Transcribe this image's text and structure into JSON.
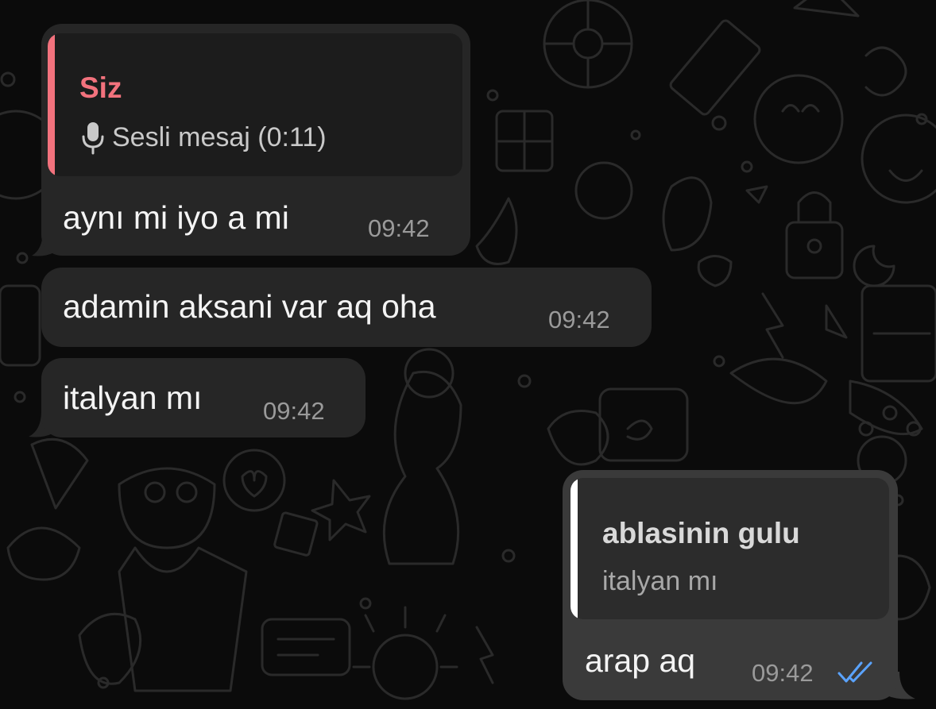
{
  "colors": {
    "incoming_bubble": "#262626",
    "outgoing_bubble": "#3a3a3a",
    "reply_accent_you": "#f2727d",
    "reply_accent_other": "#ffffff",
    "read_ticks": "#5aa3ff",
    "timestamp": "#9a9a9a"
  },
  "messages": [
    {
      "direction": "incoming",
      "reply": {
        "name": "Siz",
        "icon": "microphone-icon",
        "body": "Sesli mesaj (0:11)"
      },
      "text": "aynı mi iyo a mi",
      "time": "09:42"
    },
    {
      "direction": "incoming",
      "text": "adamin aksani var aq oha",
      "time": "09:42"
    },
    {
      "direction": "incoming",
      "text": "italyan mı",
      "time": "09:42"
    },
    {
      "direction": "outgoing",
      "reply": {
        "name": "ablasinin gulu",
        "body": "italyan mı"
      },
      "text": "arap aq",
      "time": "09:42",
      "status_icon": "double-check-read-icon"
    }
  ]
}
